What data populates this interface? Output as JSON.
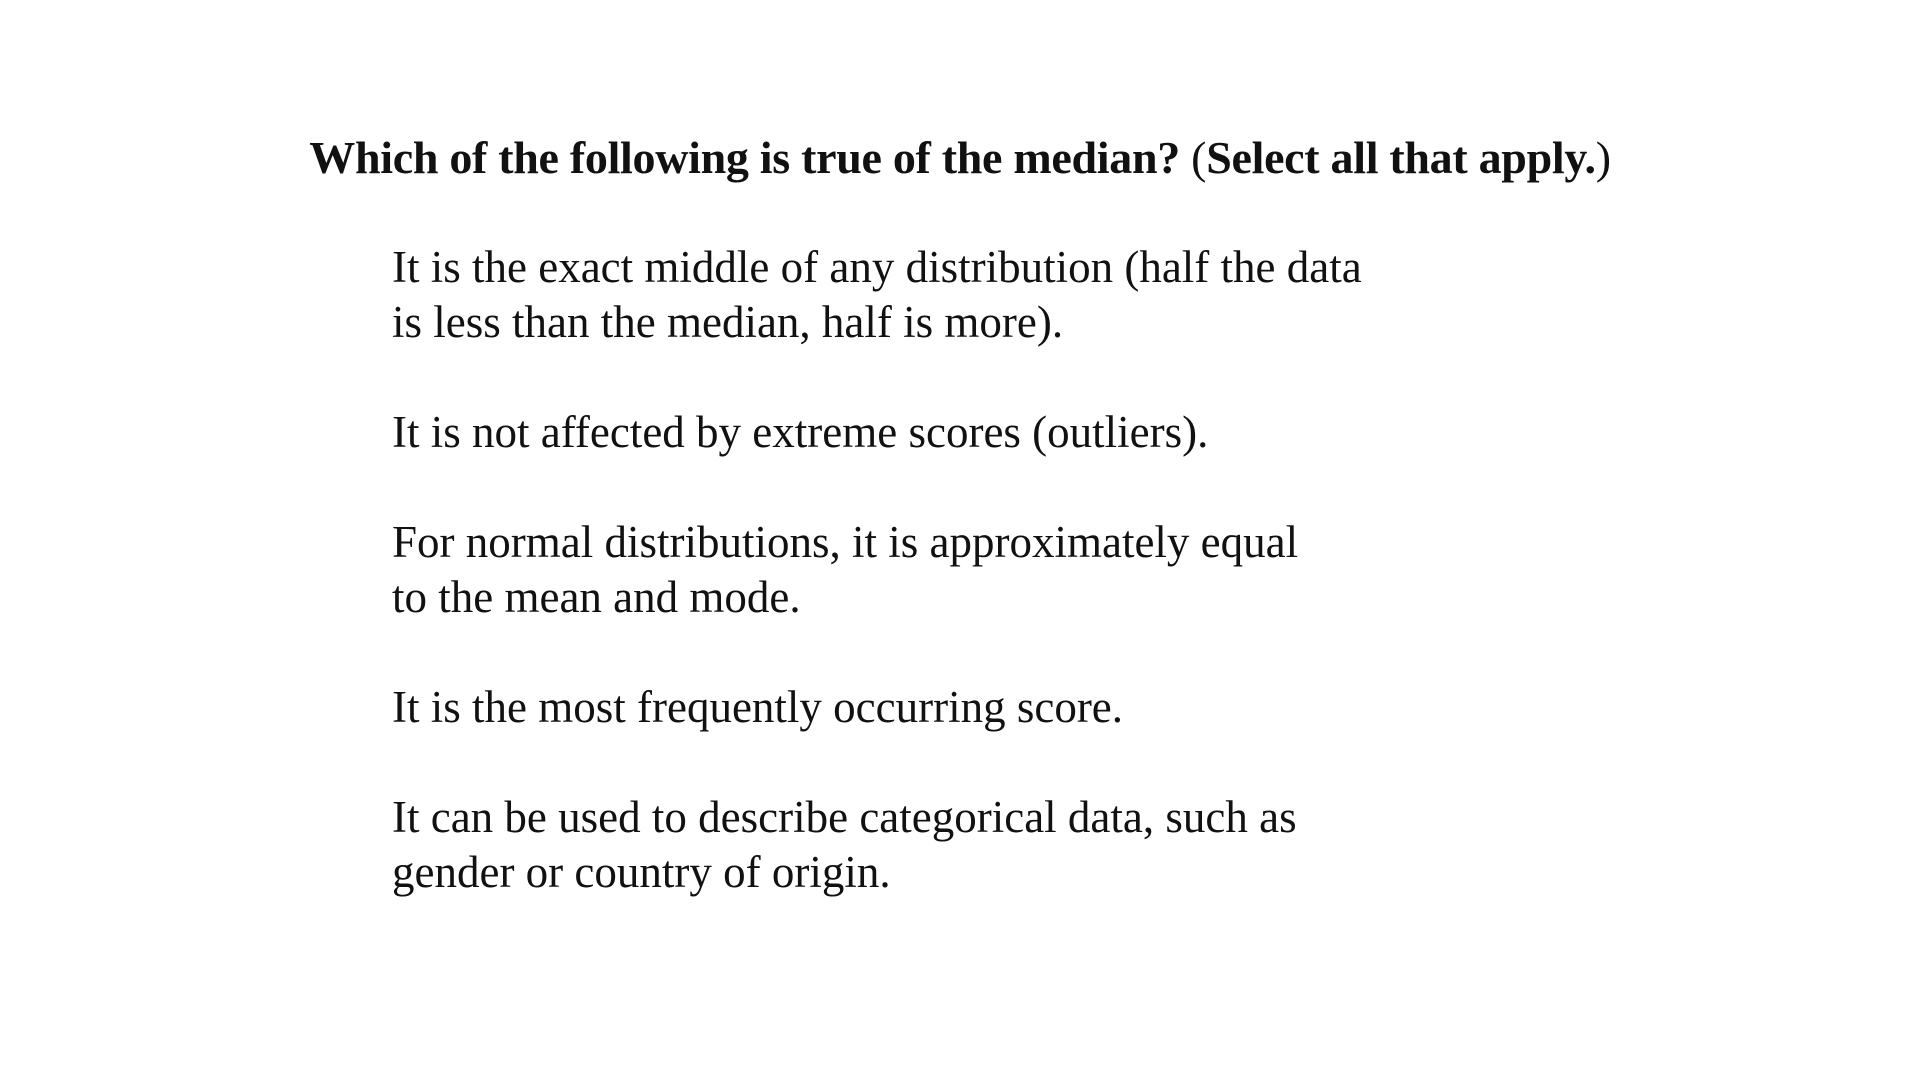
{
  "question": {
    "open_paren": "",
    "text_prefix": "Which of the following is true of the median? ",
    "paren_open": "(",
    "selection_hint": "Select all that apply.",
    "paren_close": ")"
  },
  "options": [
    {
      "label": "It is the exact middle of any distribution (half the data\nis less than the median, half is more)."
    },
    {
      "label": "It is not affected by extreme scores (outliers)."
    },
    {
      "label": "For normal distributions, it is approximately equal\nto the mean and mode."
    },
    {
      "label": "It is the most frequently occurring score."
    },
    {
      "label": "It can be used to describe categorical data, such as\ngender or country of origin."
    }
  ]
}
